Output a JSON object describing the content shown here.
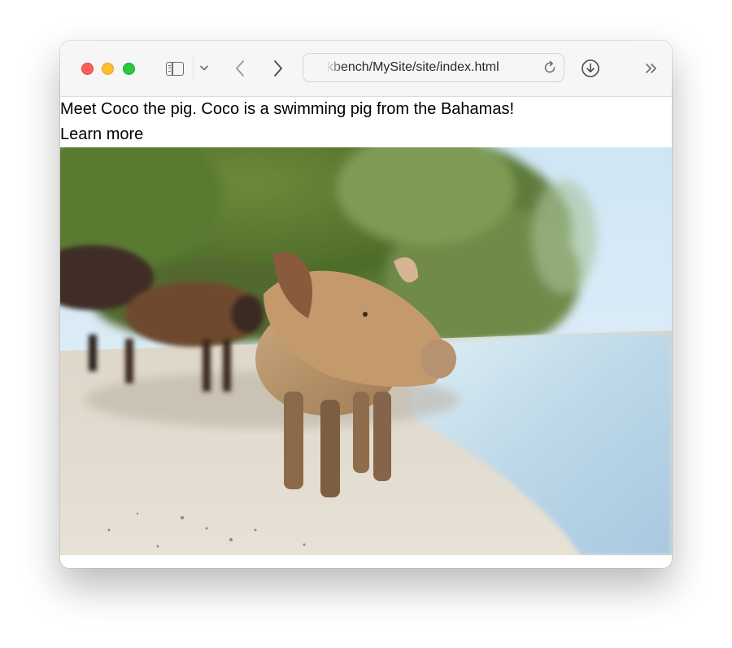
{
  "browser": {
    "url": "Workbench/MySite/site/index.html",
    "icons": {
      "sidebar": "sidebar-icon",
      "tab_overview_menu": "chevron-down-icon",
      "back": "chevron-left-icon",
      "forward": "chevron-right-icon",
      "reload": "reload-icon",
      "downloads": "download-icon",
      "more": "double-chevron-right-icon"
    }
  },
  "page": {
    "intro": "Meet Coco the pig. Coco is a swimming pig from the Bahamas!",
    "link_label": "Learn more"
  },
  "colors": {
    "close": "#ff5f57",
    "minimize": "#febc2e",
    "zoom": "#28c840"
  }
}
